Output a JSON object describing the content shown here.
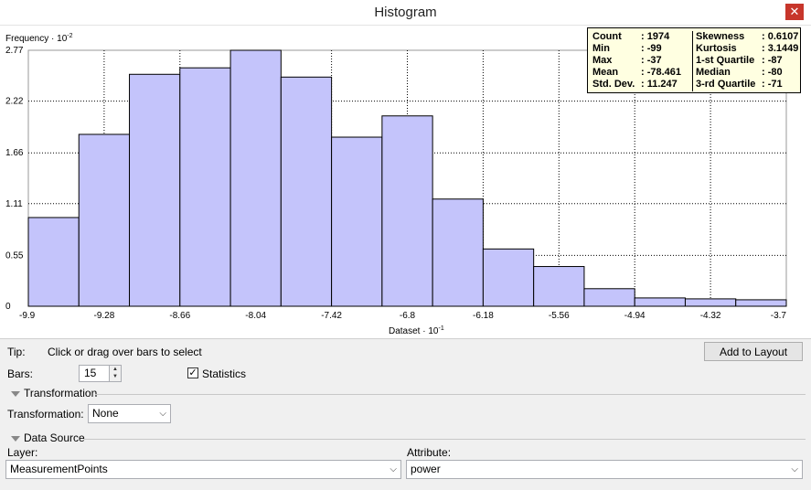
{
  "window": {
    "title": "Histogram",
    "close_glyph": "✕"
  },
  "chart_data": {
    "type": "bar",
    "ylabel": "Frequency · 10",
    "ylabel_exp": "-2",
    "xlabel": "Dataset · 10",
    "xlabel_exp": "-1",
    "bar_color": "#c4c4fb",
    "x_tick_labels": [
      "-9.9",
      "-9.28",
      "-8.66",
      "-8.04",
      "-7.42",
      "-6.8",
      "-6.18",
      "-5.56",
      "-4.94",
      "-4.32",
      "-3.7"
    ],
    "y_tick_labels": [
      "0",
      "0.55",
      "1.11",
      "1.66",
      "2.22",
      "2.77"
    ],
    "y_ticks": [
      0,
      0.55,
      1.11,
      1.66,
      2.22,
      2.77
    ],
    "ylim": [
      0,
      2.77
    ],
    "xlim": [
      -9.9,
      -3.7
    ],
    "bins": 15,
    "values": [
      0.96,
      1.86,
      2.51,
      2.58,
      2.77,
      2.48,
      1.83,
      2.06,
      1.16,
      0.62,
      0.43,
      0.19,
      0.09,
      0.08,
      0.07
    ],
    "grid": true
  },
  "stats": {
    "left": [
      {
        "label": "Count",
        "value": ": 1974"
      },
      {
        "label": "Min",
        "value": ": -99"
      },
      {
        "label": "Max",
        "value": ": -37"
      },
      {
        "label": "Mean",
        "value": ": -78.461"
      },
      {
        "label": "Std. Dev.",
        "value": ": 11.247"
      }
    ],
    "right": [
      {
        "label": "Skewness",
        "value": ": 0.6107"
      },
      {
        "label": "Kurtosis",
        "value": ": 3.1449"
      },
      {
        "label": "1-st Quartile",
        "value": ": -87"
      },
      {
        "label": "Median",
        "value": ": -80"
      },
      {
        "label": "3-rd Quartile",
        "value": ": -71"
      }
    ]
  },
  "controls": {
    "tip_label": "Tip:",
    "tip_text": "Click or drag over bars to select",
    "add_to_layout": "Add to Layout",
    "bars_label": "Bars:",
    "bars_value": "15",
    "statistics_label": "Statistics",
    "statistics_checked": "✓",
    "transformation_section": "Transformation",
    "transformation_label": "Transformation:",
    "transformation_value": "None",
    "data_source_section": "Data Source",
    "layer_label": "Layer:",
    "layer_value": "MeasurementPoints",
    "attribute_label": "Attribute:",
    "attribute_value": "power",
    "chevron": "⌵"
  }
}
